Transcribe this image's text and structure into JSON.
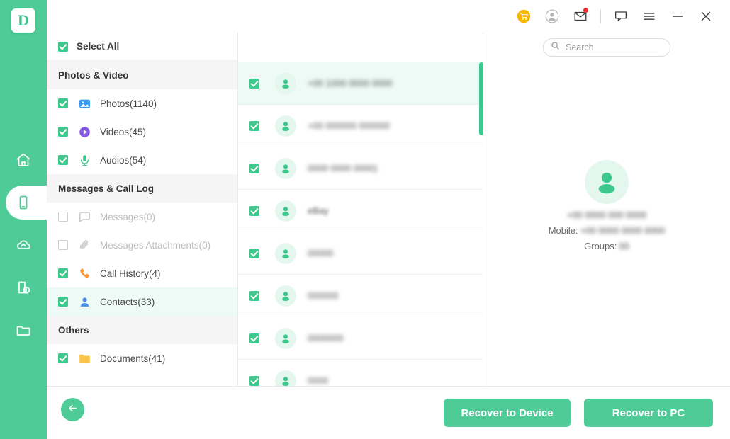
{
  "app": {
    "logo_letter": "D",
    "accent": "#4ecb96",
    "checkbox_green": "#3dc98e",
    "selected_row_bg": "#eefaf5",
    "badge_red": "#f4322c",
    "cart_orange": "#f7b500"
  },
  "titlebar": {
    "icons": [
      {
        "name": "cart-icon",
        "title": "Store"
      },
      {
        "name": "account-icon",
        "title": "Account"
      },
      {
        "name": "mail-icon",
        "title": "Messages",
        "badge": true
      },
      {
        "name": "feedback-icon",
        "title": "Feedback"
      },
      {
        "name": "menu-icon",
        "title": "Menu"
      },
      {
        "name": "minimize-icon",
        "title": "Minimize"
      },
      {
        "name": "close-icon",
        "title": "Close"
      }
    ]
  },
  "rail": {
    "items": [
      {
        "name": "home",
        "active": false
      },
      {
        "name": "device",
        "active": true
      },
      {
        "name": "cloud",
        "active": false
      },
      {
        "name": "broken-device",
        "active": false
      },
      {
        "name": "folder",
        "active": false
      }
    ]
  },
  "sidebar": {
    "select_all_label": "Select All",
    "select_all_checked": true,
    "groups": [
      {
        "title": "Photos & Video",
        "items": [
          {
            "label": "Photos(1140)",
            "icon": "photos-icon",
            "checked": true,
            "enabled": true,
            "selected": false
          },
          {
            "label": "Videos(45)",
            "icon": "videos-icon",
            "checked": true,
            "enabled": true,
            "selected": false
          },
          {
            "label": "Audios(54)",
            "icon": "audios-icon",
            "checked": true,
            "enabled": true,
            "selected": false
          }
        ]
      },
      {
        "title": "Messages & Call Log",
        "items": [
          {
            "label": "Messages(0)",
            "icon": "messages-icon",
            "checked": false,
            "enabled": false,
            "selected": false
          },
          {
            "label": "Messages Attachments(0)",
            "icon": "attachment-icon",
            "checked": false,
            "enabled": false,
            "selected": false
          },
          {
            "label": "Call History(4)",
            "icon": "call-history-icon",
            "checked": true,
            "enabled": true,
            "selected": false
          },
          {
            "label": "Contacts(33)",
            "icon": "contacts-icon",
            "checked": true,
            "enabled": true,
            "selected": true
          }
        ]
      },
      {
        "title": "Others",
        "items": [
          {
            "label": "Documents(41)",
            "icon": "documents-icon",
            "checked": true,
            "enabled": true,
            "selected": false
          }
        ]
      }
    ]
  },
  "search": {
    "placeholder": "Search",
    "value": ""
  },
  "contact_list": {
    "scrollbar_visible": true,
    "rows": [
      {
        "name": "+00 1000 0000 0000",
        "checked": true,
        "selected": true,
        "redacted": true
      },
      {
        "name": "+00 000000 000000",
        "checked": true,
        "selected": false,
        "redacted": true
      },
      {
        "name": "0000 0000 0000)",
        "checked": true,
        "selected": false,
        "redacted": true
      },
      {
        "name": "eBay",
        "checked": true,
        "selected": false,
        "redacted": true
      },
      {
        "name": "00000",
        "checked": true,
        "selected": false,
        "redacted": true
      },
      {
        "name": "000000",
        "checked": true,
        "selected": false,
        "redacted": true
      },
      {
        "name": "0000000",
        "checked": true,
        "selected": false,
        "redacted": true
      },
      {
        "name": "0000",
        "checked": true,
        "selected": false,
        "redacted": true
      }
    ]
  },
  "detail": {
    "avatar_icon": "contact-avatar-icon",
    "title": "+00 0000 000 0000",
    "mobile_label": "Mobile:",
    "mobile_value": "+00 0000 0000 0000",
    "groups_label": "Groups:",
    "groups_value": "00",
    "redacted": true
  },
  "footer": {
    "back_icon": "back-arrow-icon",
    "recover_to_device": "Recover to Device",
    "recover_to_pc": "Recover to PC"
  }
}
